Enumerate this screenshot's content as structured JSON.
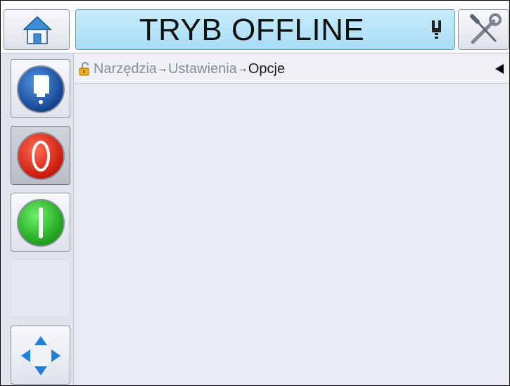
{
  "header": {
    "status_title": "TRYB OFFLINE"
  },
  "breadcrumb": {
    "items": [
      "Narzędzia",
      "Ustawienia"
    ],
    "current": "Opcje",
    "separator": "→"
  },
  "icons": {
    "home": "home-icon",
    "tools": "tools-icon",
    "printhead": "printhead-status-icon",
    "ink": "ink-icon",
    "stop": "stop-icon",
    "start": "start-icon",
    "navigate": "navigation-arrows-icon",
    "lock": "lock-icon",
    "back": "back-arrow-icon"
  },
  "colors": {
    "banner": "#a9dcf6",
    "ink_button": "#1f5fb3",
    "stop_button": "#e8311c",
    "start_button": "#2fc42c",
    "nav_arrows": "#1f7fd6"
  }
}
